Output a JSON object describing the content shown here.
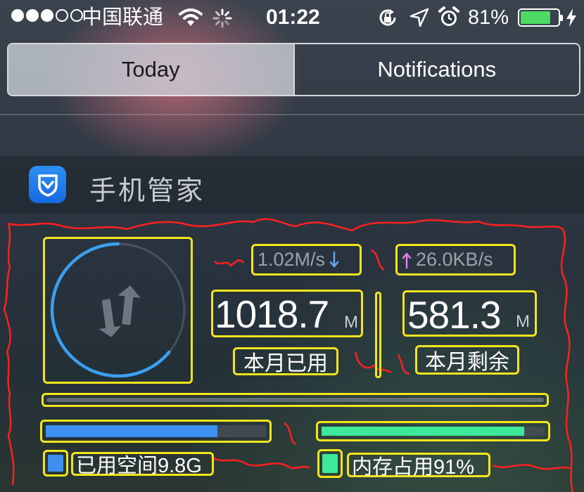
{
  "status_bar": {
    "signal_bars_filled": 3,
    "signal_bars_total": 5,
    "carrier": "中国联通",
    "time": "01:22",
    "battery_percent": "81%",
    "battery_level": 0.81,
    "icons": [
      "wifi-icon",
      "activity-spinner-icon",
      "rotation-lock-icon",
      "location-arrow-icon",
      "alarm-clock-icon",
      "battery-icon",
      "charging-bolt-icon"
    ]
  },
  "segmented": {
    "today_label": "Today",
    "notifications_label": "Notifications",
    "selected": "Today"
  },
  "widget": {
    "app_name": "手机管家",
    "app_icon": "shield-check-icon",
    "download_speed": "1.02M/s",
    "upload_speed": "26.0KB/s",
    "used_amount": "1018.7",
    "used_unit": "M",
    "used_label": "本月已用",
    "remaining_amount": "581.3",
    "remaining_unit": "M",
    "remaining_label": "本月剩余",
    "data_ring_level": 0.64,
    "storage_label": "已用空间9.8G",
    "storage_level": 0.78,
    "memory_label": "内存占用91%",
    "memory_level": 0.91
  },
  "colors": {
    "accent_blue": "#3aa0f0",
    "storage_blue": "#3d8ff0",
    "memory_green": "#3de89a",
    "annotation_red": "#ff2020",
    "highlight_yellow": "#f2e51c",
    "upload_pink": "#e07fe6",
    "download_blue": "#6aa8f0"
  }
}
